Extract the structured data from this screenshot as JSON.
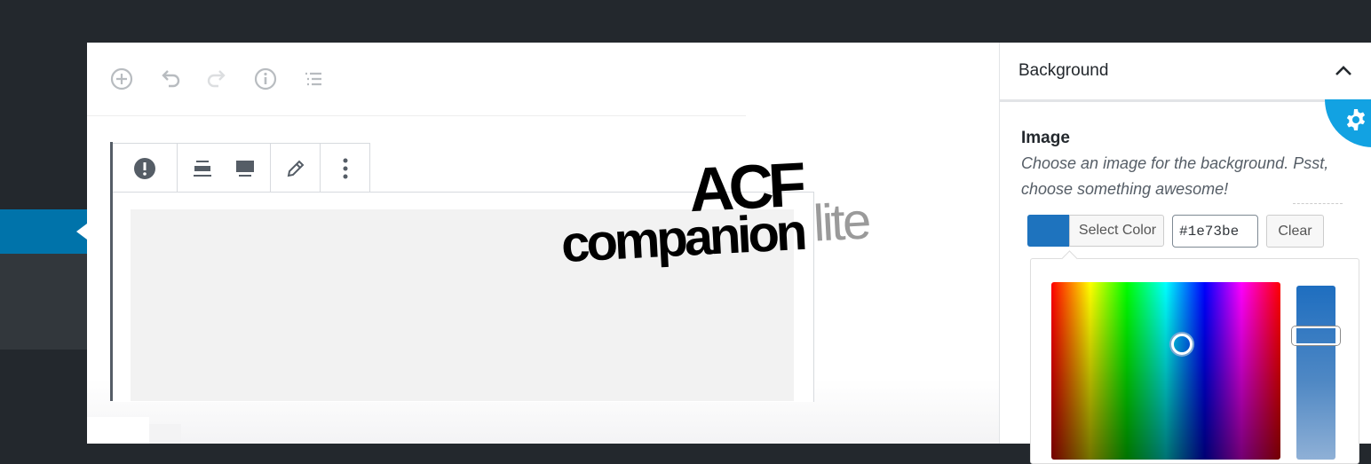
{
  "settings": {
    "panel_title": "Background",
    "field_label": "Image",
    "field_description": "Choose an image for the background. Psst, choose something awesome!",
    "color": {
      "select_label": "Select Color",
      "hex_value": "#1e73be",
      "clear_label": "Clear",
      "swatch_color": "#1e73be"
    }
  },
  "logo": {
    "acf": "ACF",
    "companion": "companion",
    "lite": "lite"
  },
  "colors": {
    "admin_bg": "#23282d",
    "admin_active": "#0073aa",
    "accent": "#12a2e2"
  },
  "icons": {
    "toolbar": [
      "add-block-icon",
      "undo-icon",
      "redo-icon",
      "info-icon",
      "list-view-icon"
    ],
    "block_toolbar": [
      "warning-icon",
      "align-wide-icon",
      "align-full-icon",
      "edit-icon",
      "more-options-icon"
    ]
  }
}
